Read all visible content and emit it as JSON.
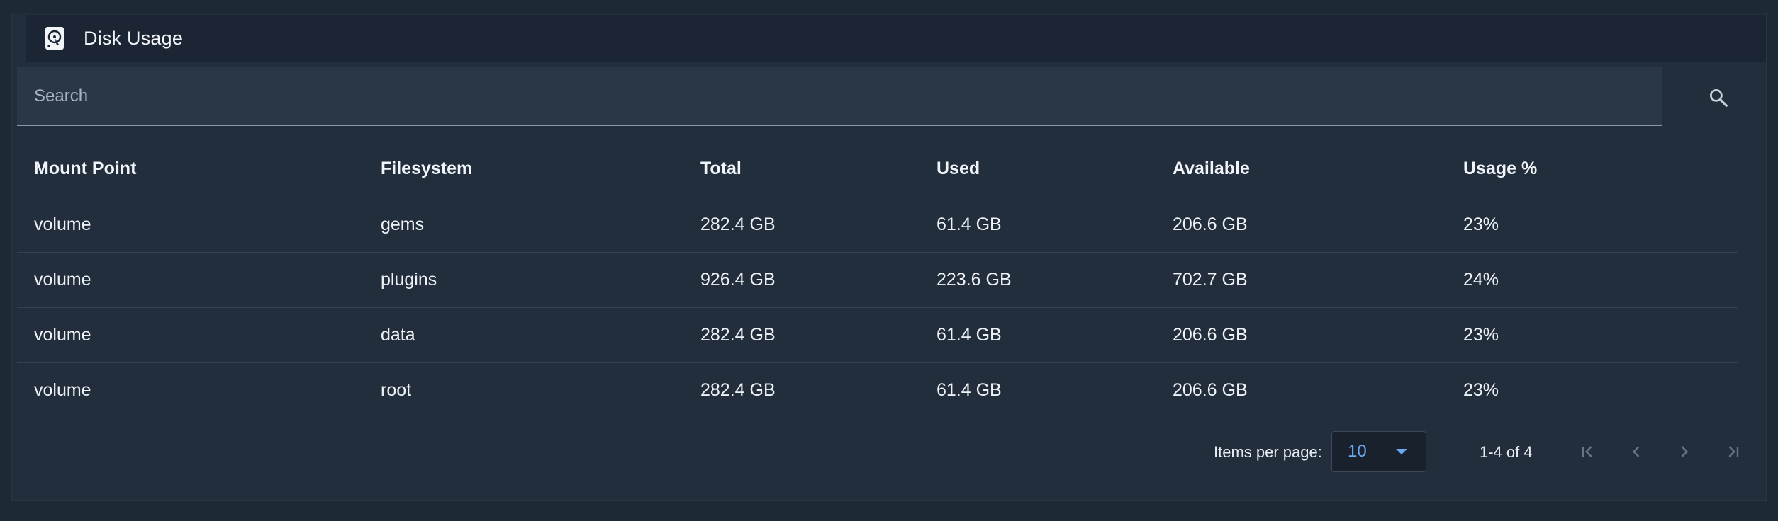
{
  "header": {
    "title": "Disk Usage",
    "icon": "hard-disk-icon"
  },
  "search": {
    "placeholder": "Search",
    "value": "",
    "icon": "search-icon"
  },
  "table": {
    "columns": [
      "Mount Point",
      "Filesystem",
      "Total",
      "Used",
      "Available",
      "Usage %"
    ],
    "rows": [
      [
        "volume",
        "gems",
        "282.4 GB",
        "61.4 GB",
        "206.6 GB",
        "23%"
      ],
      [
        "volume",
        "plugins",
        "926.4 GB",
        "223.6 GB",
        "702.7 GB",
        "24%"
      ],
      [
        "volume",
        "data",
        "282.4 GB",
        "61.4 GB",
        "206.6 GB",
        "23%"
      ],
      [
        "volume",
        "root",
        "282.4 GB",
        "61.4 GB",
        "206.6 GB",
        "23%"
      ]
    ]
  },
  "paginator": {
    "items_per_page_label": "Items per page:",
    "items_per_page_value": "10",
    "range_label": "1-4 of 4",
    "first_icon": "first-page-icon",
    "prev_icon": "chevron-left-icon",
    "next_icon": "chevron-right-icon",
    "last_icon": "last-page-icon"
  },
  "colors": {
    "background": "#1e2936",
    "card": "#222e3c",
    "header": "#1b2533",
    "accent": "#6aa8f0"
  }
}
